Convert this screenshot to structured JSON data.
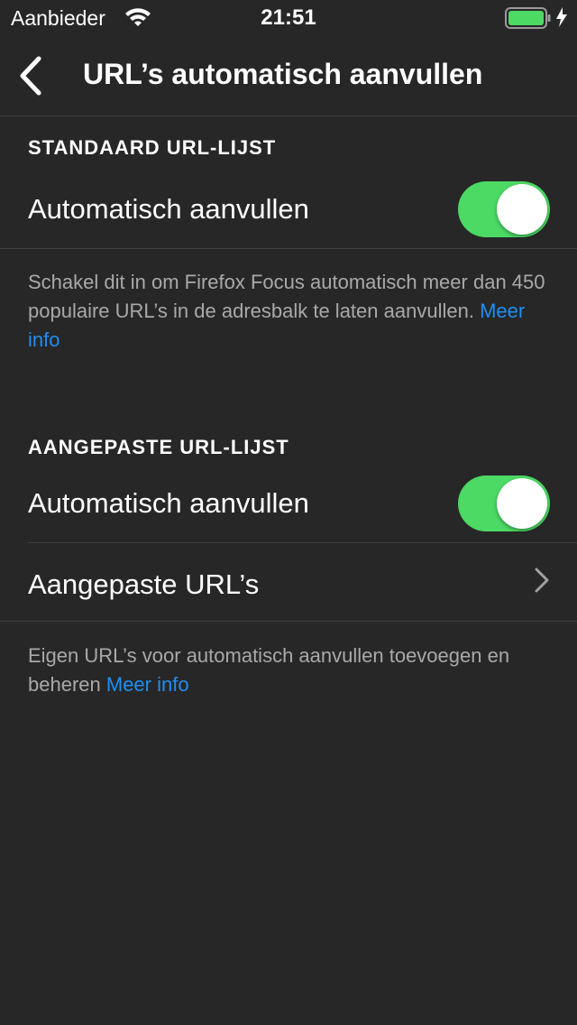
{
  "status_bar": {
    "carrier": "Aanbieder",
    "time": "21:51"
  },
  "nav": {
    "title": "URL’s automatisch aanvullen"
  },
  "colors": {
    "accent": "#1d8ff5",
    "toggle_on": "#4cd964",
    "background": "#272727"
  },
  "standard_section": {
    "header": "STANDAARD URL-LIJST",
    "autocomplete_label": "Automatisch aanvullen",
    "autocomplete_enabled": true,
    "footer": "Schakel dit in om Firefox Focus automatisch meer dan 450 populaire URL’s in de adresbalk te laten aanvullen.",
    "footer_link": "Meer info"
  },
  "custom_section": {
    "header": "AANGEPASTE URL-LIJST",
    "autocomplete_label": "Automatisch aanvullen",
    "autocomplete_enabled": true,
    "custom_urls_label": "Aangepaste URL’s",
    "footer": "Eigen URL’s voor automatisch aanvullen toevoegen en beheren",
    "footer_link": "Meer info"
  }
}
